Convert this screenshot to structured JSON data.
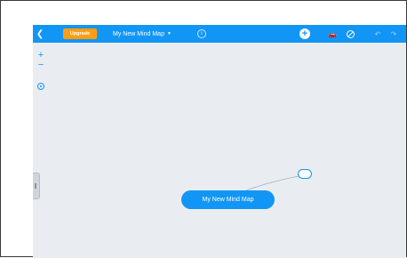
{
  "toolbar": {
    "back_icon": "chevron-left-icon",
    "upgrade_label": "Upgrade",
    "title": "My New Mind Map",
    "title_caret_icon": "caret-down-icon",
    "info_icon": "info-icon",
    "add_icon": "plus-circle-icon",
    "style_icon": "car-icon",
    "hide_icon": "no-entry-icon",
    "undo_icon": "undo-icon",
    "redo_icon": "redo-icon"
  },
  "canvas": {
    "zoom_in_label": "+",
    "zoom_out_label": "−",
    "root_node_label": "My New Mind Map",
    "child_node_label": ""
  },
  "colors": {
    "toolbar": "#1296f5",
    "upgrade": "#ff9d12",
    "canvas": "#e9edf2"
  }
}
